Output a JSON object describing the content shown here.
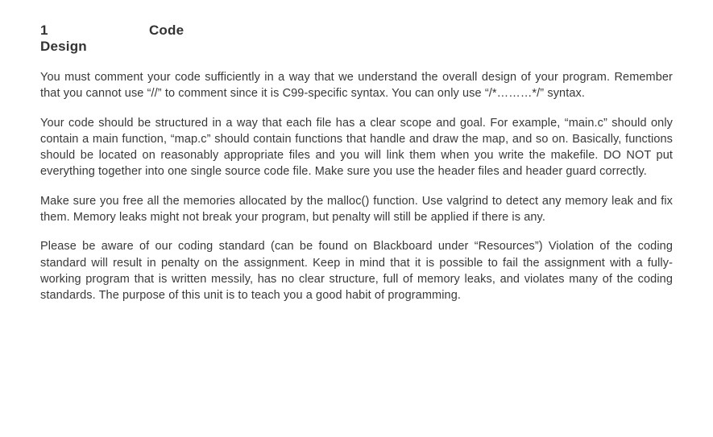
{
  "heading": {
    "number": "1",
    "title_word1": "Code",
    "title_word2": "Design"
  },
  "paragraphs": {
    "p1": "You must comment your code sufficiently in a way that we understand the overall design of your program. Remember that you cannot use “//” to comment since it is C99-specific syntax. You can only use “/*………*/” syntax.",
    "p2": "Your code should be structured in a way that each file has a clear scope and goal. For example, “main.c” should only contain a main function, “map.c” should contain functions that handle and draw the map, and so on. Basically, functions should be located on reasonably appropriate files and you will link them when you write the makefile.  DO NOT put everything together into one single source code file. Make sure you use the header files and header guard correctly.",
    "p3": "Make sure you free all the memories allocated by the malloc() function. Use valgrind to detect any memory leak and fix them. Memory leaks might not break your program, but penalty will still be applied if there is any.",
    "p4": "Please be aware of our coding standard (can be found on Blackboard under “Resources”) Violation of the coding standard will result in penalty on the assignment.  Keep in mind that it is possible to fail the assignment with a fully-working program that is written messily, has no clear structure, full of memory leaks, and violates many of the coding standards. The purpose of this unit is to teach you a good habit of programming."
  }
}
